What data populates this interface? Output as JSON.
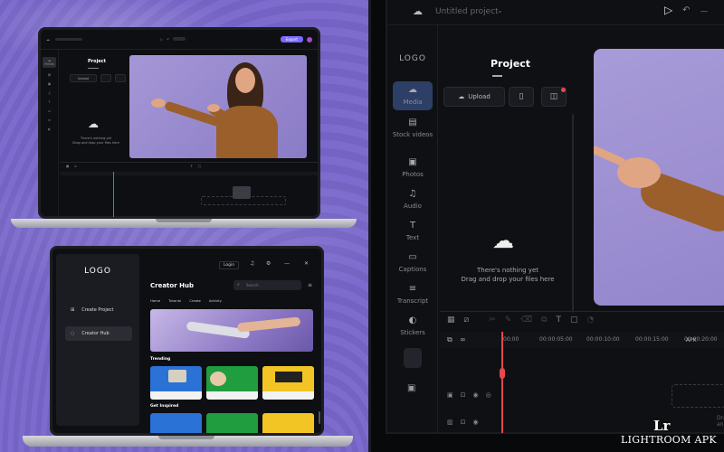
{
  "laptop1": {
    "project_title": "Project",
    "sidebar_items": [
      "Media",
      "Stock videos",
      "Photos",
      "Audio",
      "Text",
      "Captions",
      "Transcript",
      "Stickers"
    ],
    "upload_label": "Upload",
    "empty_text_1": "There's nothing yet",
    "empty_text_2": "Drag and drop your files here",
    "export_label": "Export"
  },
  "laptop2": {
    "logo": "LOGO",
    "login_label": "Login",
    "nav": [
      {
        "label": "Create Project",
        "icon": "plus-icon"
      },
      {
        "label": "Creator Hub",
        "icon": "compass-icon"
      }
    ],
    "hub_title": "Creator Hub",
    "search_placeholder": "Search",
    "tabs": [
      "Home",
      "Tutorial",
      "Create",
      "Activity"
    ],
    "trending_label": "Trending",
    "get_inspired_label": "Get Inspired"
  },
  "editor": {
    "app_title": "Untitled project",
    "logo": "LOGO",
    "project_title": "Project",
    "sidebar_items": [
      {
        "label": "Media",
        "icon": "cloud-upload-icon"
      },
      {
        "label": "Stock videos",
        "icon": "film-icon"
      },
      {
        "label": "Photos",
        "icon": "photo-icon"
      },
      {
        "label": "Audio",
        "icon": "music-icon"
      },
      {
        "label": "Text",
        "icon": "text-icon"
      },
      {
        "label": "Captions",
        "icon": "captions-icon"
      },
      {
        "label": "Transcript",
        "icon": "transcript-icon"
      },
      {
        "label": "Stickers",
        "icon": "sticker-icon"
      }
    ],
    "upload_label": "Upload",
    "empty_text_1": "There's nothing yet",
    "empty_text_2": "Drag and drop your files here",
    "timecodes": [
      "00:00",
      "00:00:05:00",
      "00:00:10:00",
      "00:00:15:00",
      "00:00:20:00"
    ],
    "apk_partial": "APK",
    "drag_partial": "Drag an"
  },
  "watermark": {
    "lr": "Lr",
    "text": "LIGHTROOM APK"
  },
  "colors": {
    "background": "#7766c4",
    "accent": "#7b6bff",
    "playhead": "#e5484d",
    "sweater": "#9a5f2a"
  }
}
